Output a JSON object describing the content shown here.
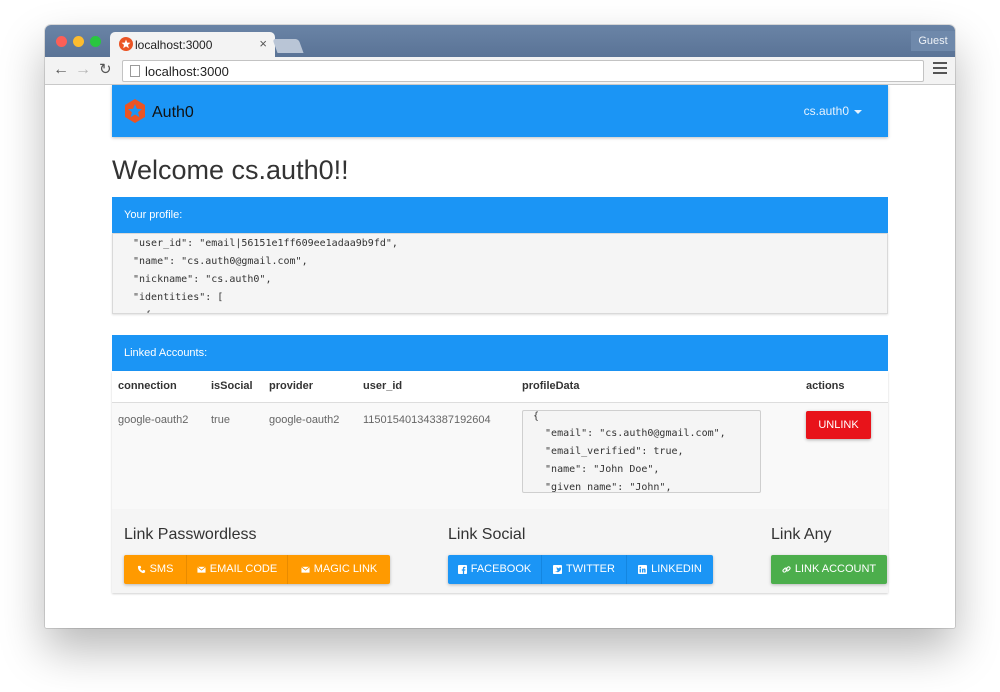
{
  "browser": {
    "tab_title": "localhost:3000",
    "tab_close": "×",
    "url": "localhost:3000",
    "profile_label": "Guest"
  },
  "app": {
    "brand": "Auth0",
    "user_menu": "cs.auth0",
    "welcome": "Welcome cs.auth0!!"
  },
  "profile": {
    "heading": "Your profile:",
    "lines": [
      "\"user_id\": \"email|56151e1ff609ee1adaa9b9fd\",",
      "\"name\": \"cs.auth0@gmail.com\",",
      "\"nickname\": \"cs.auth0\",",
      "\"identities\": [",
      "  {"
    ]
  },
  "linked_accounts": {
    "heading": "Linked Accounts:",
    "columns": [
      "connection",
      "isSocial",
      "provider",
      "user_id",
      "profileData",
      "actions"
    ],
    "rows": [
      {
        "connection": "google-oauth2",
        "isSocial": "true",
        "provider": "google-oauth2",
        "user_id": "115015401343387192604",
        "profileData": [
          "{",
          "  \"email\": \"cs.auth0@gmail.com\",",
          "  \"email_verified\": true,",
          "  \"name\": \"John Doe\",",
          "  \"given_name\": \"John\","
        ],
        "action_label": "UNLINK"
      }
    ]
  },
  "link": {
    "passwordless_title": "Link Passwordless",
    "social_title": "Link Social",
    "any_title": "Link Any",
    "sms": "SMS",
    "email_code": "EMAIL CODE",
    "magic_link": "MAGIC LINK",
    "facebook": "FACEBOOK",
    "twitter": "TWITTER",
    "linkedin": "LINKEDIN",
    "link_account": "LINK ACCOUNT"
  },
  "colors": {
    "primary": "#1b95f5",
    "danger": "#e8131a",
    "warning": "#ff9a00",
    "success": "#4cae4c",
    "auth0_logo": "#eb5424"
  }
}
